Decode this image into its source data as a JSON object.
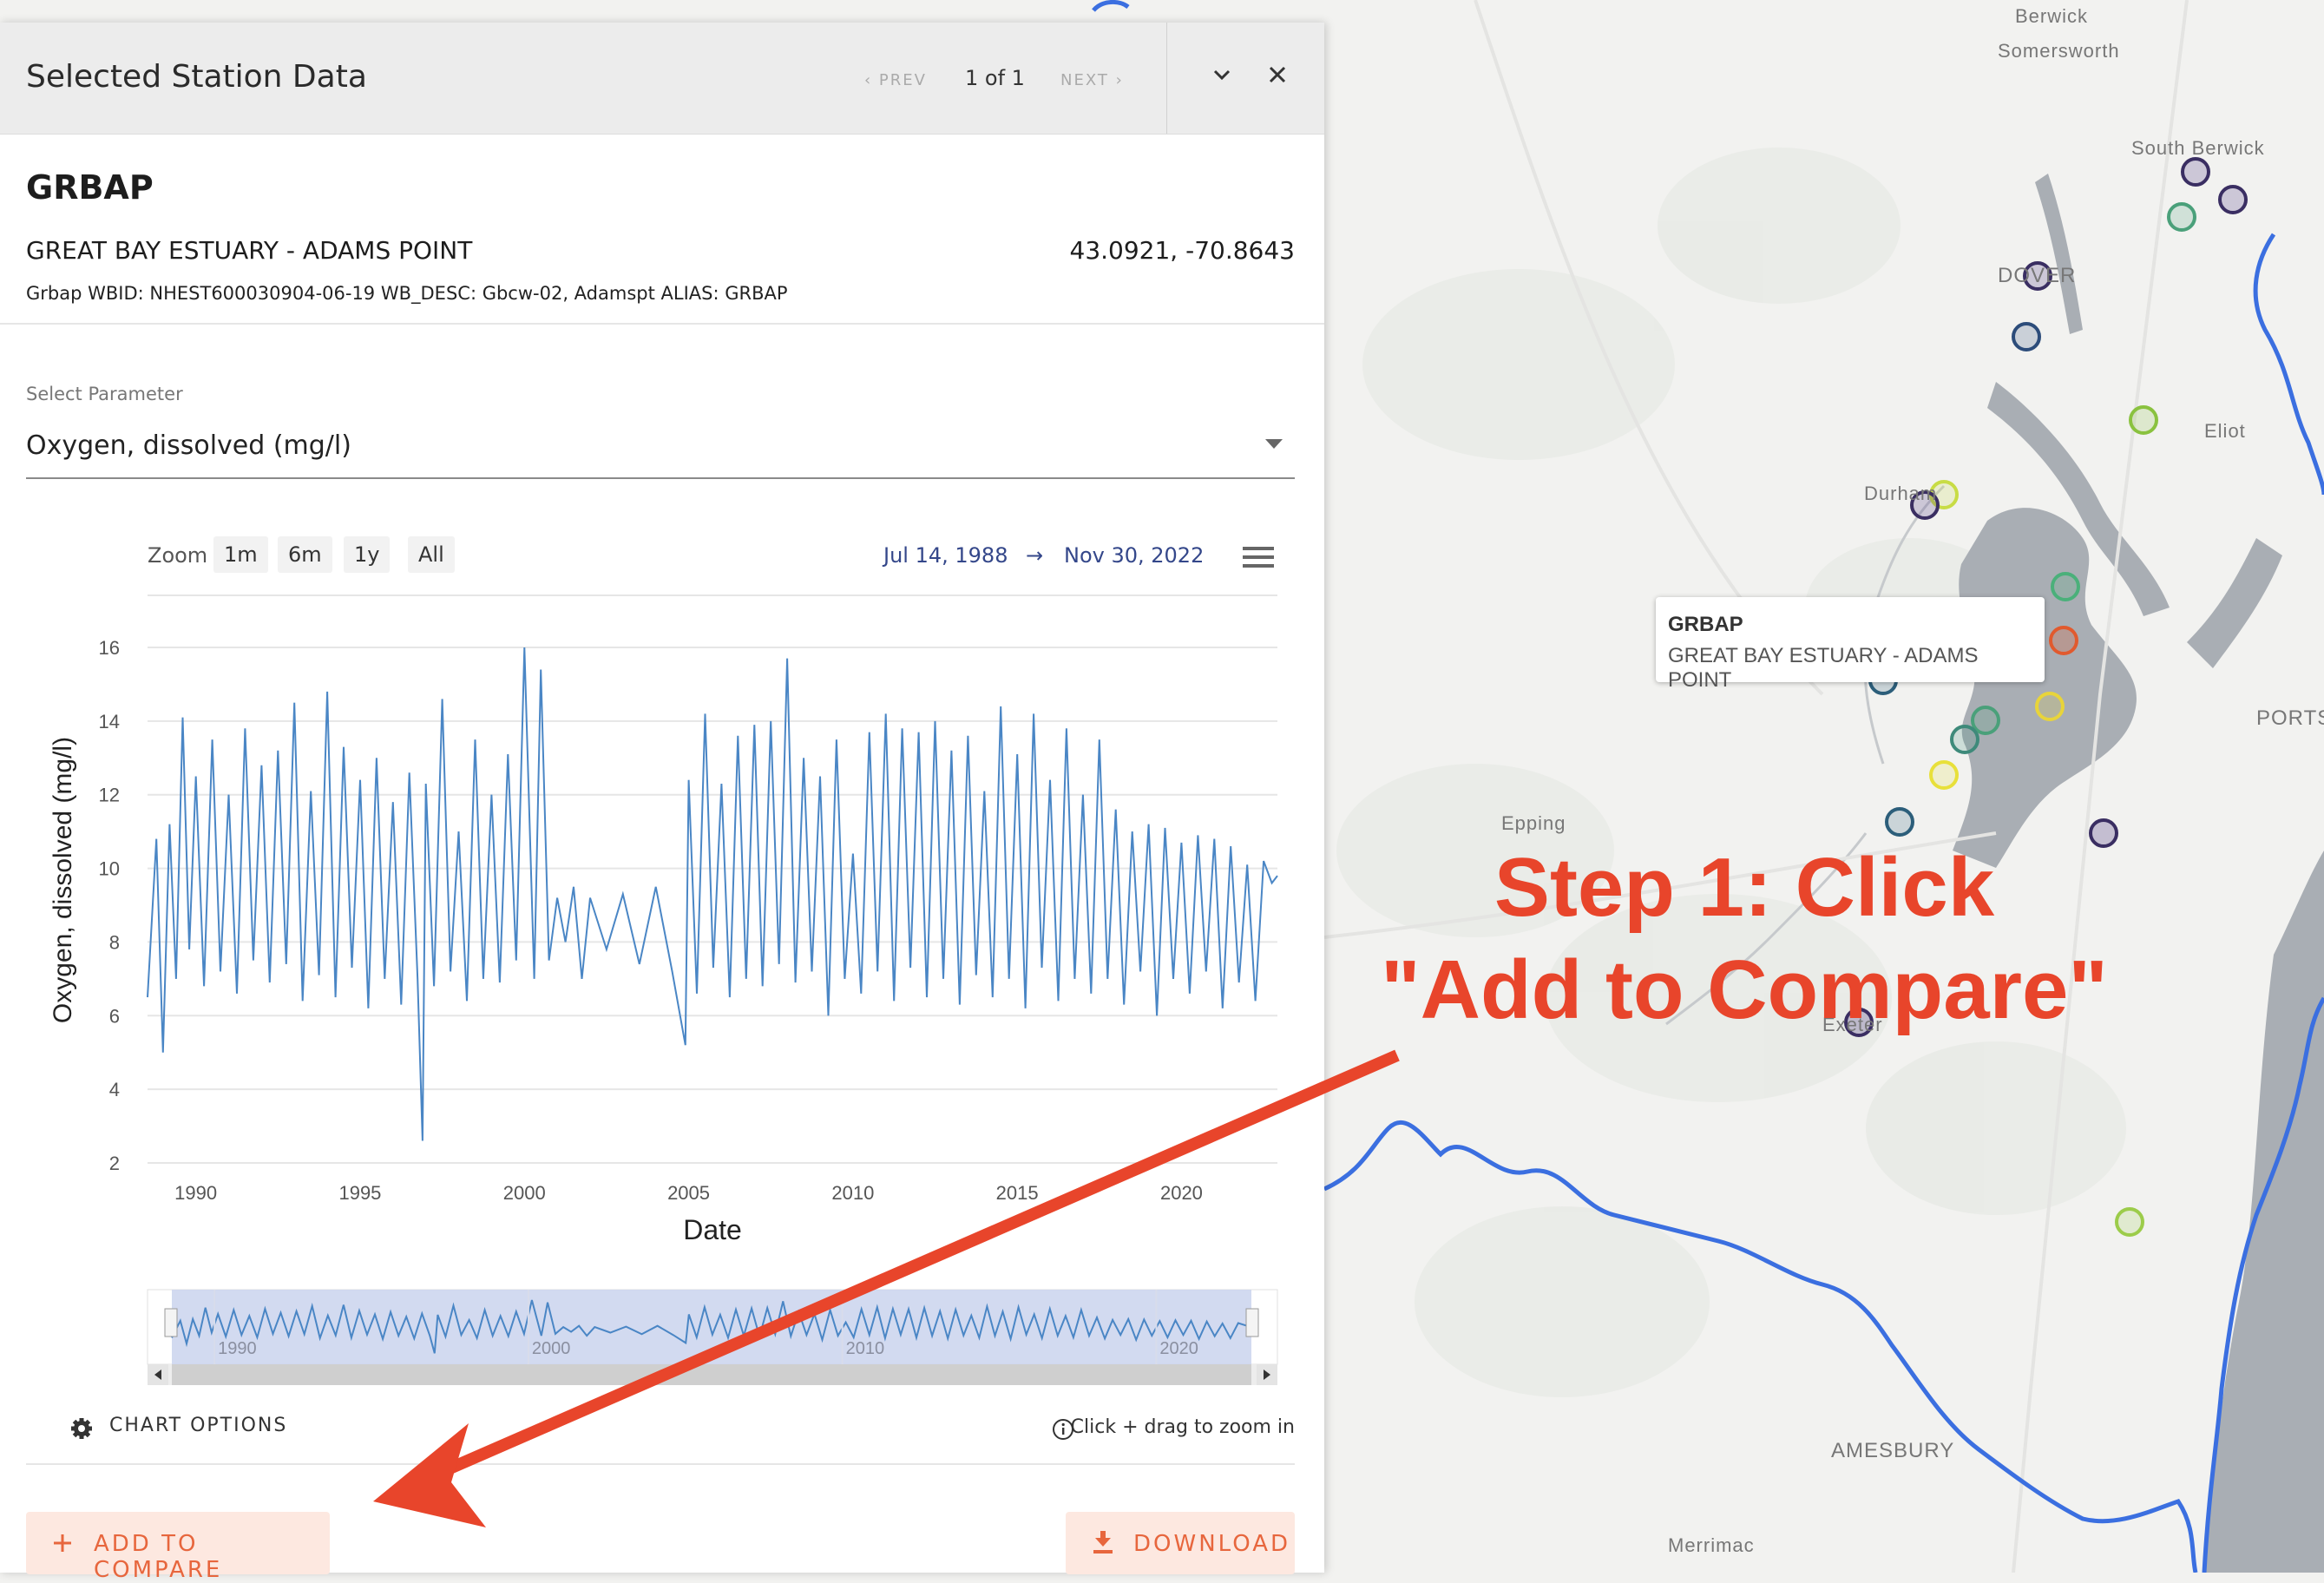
{
  "panel": {
    "title": "Selected Station Data",
    "prev": "‹ PREV",
    "count": "1 of 1",
    "next": "NEXT ›",
    "icons": {
      "collapse": "chevron-down-icon",
      "close": "close-icon"
    }
  },
  "station": {
    "id": "GRBAP",
    "name": "GREAT BAY ESTUARY - ADAMS POINT",
    "coords": "43.0921, -70.8643",
    "meta": "Grbap WBID: NHEST600030904-06-19 WB_DESC: Gbcw-02, Adamspt ALIAS: GRBAP"
  },
  "parameter": {
    "label": "Select Parameter",
    "value": "Oxygen, dissolved (mg/l)"
  },
  "zoom": {
    "label": "Zoom",
    "buttons": [
      "1m",
      "6m",
      "1y",
      "All"
    ],
    "from": "Jul 14, 1988",
    "arrow": "→",
    "to": "Nov 30, 2022"
  },
  "chart_data": {
    "type": "line",
    "ylabel": "Oxygen, dissolved (mg/l)",
    "xlabel": "Date",
    "ylim": [
      2,
      16
    ],
    "yticks": [
      2,
      4,
      6,
      8,
      10,
      12,
      14,
      16
    ],
    "xlim": [
      1988.53,
      2022.92
    ],
    "xticks": [
      1990,
      1995,
      2000,
      2005,
      2010,
      2015,
      2020
    ],
    "navigator_ticks": [
      "1990",
      "2000",
      "2010",
      "2020"
    ],
    "series": [
      {
        "color": "#4a86c5",
        "x": [
          1988.53,
          1988.8,
          1989.0,
          1989.2,
          1989.4,
          1989.6,
          1989.8,
          1990.0,
          1990.25,
          1990.5,
          1990.75,
          1991.0,
          1991.25,
          1991.5,
          1991.75,
          1992.0,
          1992.25,
          1992.5,
          1992.75,
          1993.0,
          1993.25,
          1993.5,
          1993.75,
          1994.0,
          1994.25,
          1994.5,
          1994.75,
          1995.0,
          1995.25,
          1995.5,
          1995.75,
          1996.0,
          1996.25,
          1996.5,
          1996.75,
          1996.9,
          1997.0,
          1997.25,
          1997.5,
          1997.75,
          1998.0,
          1998.25,
          1998.5,
          1998.75,
          1999.0,
          1999.25,
          1999.5,
          1999.75,
          2000.0,
          2000.3,
          2000.5,
          2000.75,
          2001.0,
          2001.25,
          2001.5,
          2001.75,
          2002.0,
          2002.5,
          2003.0,
          2003.5,
          2004.0,
          2004.5,
          2004.9,
          2005.0,
          2005.25,
          2005.5,
          2005.75,
          2006.0,
          2006.25,
          2006.5,
          2006.75,
          2007.0,
          2007.25,
          2007.5,
          2007.75,
          2008.0,
          2008.25,
          2008.5,
          2008.75,
          2009.0,
          2009.25,
          2009.5,
          2009.75,
          2010.0,
          2010.25,
          2010.5,
          2010.75,
          2011.0,
          2011.25,
          2011.5,
          2011.75,
          2012.0,
          2012.25,
          2012.5,
          2012.75,
          2013.0,
          2013.25,
          2013.5,
          2013.75,
          2014.0,
          2014.25,
          2014.5,
          2014.75,
          2015.0,
          2015.25,
          2015.5,
          2015.75,
          2016.0,
          2016.25,
          2016.5,
          2016.75,
          2017.0,
          2017.25,
          2017.5,
          2017.75,
          2018.0,
          2018.25,
          2018.5,
          2018.75,
          2019.0,
          2019.25,
          2019.5,
          2019.75,
          2020.0,
          2020.25,
          2020.5,
          2020.75,
          2021.0,
          2021.25,
          2021.5,
          2021.75,
          2022.0,
          2022.25,
          2022.5,
          2022.75,
          2022.92
        ],
        "values": [
          6.5,
          10.8,
          5.0,
          11.2,
          7.0,
          14.1,
          7.8,
          12.5,
          6.8,
          13.5,
          7.2,
          12.0,
          6.6,
          13.8,
          7.5,
          12.8,
          6.9,
          13.2,
          7.4,
          14.5,
          6.4,
          12.1,
          7.1,
          14.8,
          6.5,
          13.3,
          7.3,
          12.4,
          6.2,
          13.0,
          7.0,
          11.8,
          6.3,
          12.6,
          7.0,
          2.6,
          12.3,
          6.8,
          14.6,
          7.2,
          11.0,
          6.4,
          13.5,
          7.0,
          12.0,
          6.9,
          13.1,
          7.5,
          16.0,
          7.0,
          15.4,
          7.5,
          9.2,
          8.0,
          9.5,
          7.0,
          9.2,
          7.8,
          9.3,
          7.4,
          9.5,
          7.2,
          5.2,
          12.4,
          6.6,
          14.2,
          7.3,
          12.3,
          6.5,
          13.6,
          7.0,
          13.9,
          6.8,
          14.0,
          7.4,
          15.7,
          6.9,
          13.0,
          7.2,
          12.5,
          6.0,
          13.5,
          7.0,
          10.4,
          6.6,
          13.7,
          7.2,
          14.2,
          6.4,
          13.8,
          7.3,
          13.7,
          6.5,
          14.0,
          7.0,
          13.2,
          6.3,
          13.6,
          7.1,
          12.1,
          6.5,
          14.4,
          7.0,
          13.1,
          6.2,
          14.2,
          7.3,
          12.4,
          6.4,
          13.8,
          7.0,
          12.0,
          6.6,
          13.5,
          7.0,
          11.6,
          6.3,
          11.0,
          7.2,
          11.2,
          6.0,
          11.1,
          7.0,
          10.7,
          6.6,
          10.9,
          7.2,
          10.8,
          6.2,
          10.6,
          6.9,
          10.1,
          6.4,
          10.2,
          9.6,
          9.8
        ]
      }
    ]
  },
  "chart_options": {
    "label": "CHART OPTIONS",
    "icon": "gear-icon"
  },
  "hint": {
    "text": "Click + drag to zoom in",
    "icon": "info-icon"
  },
  "actions": {
    "compare": "ADD TO COMPARE",
    "compare_icon": "plus-icon",
    "download": "DOWNLOAD",
    "download_icon": "download-icon"
  },
  "tooltip": {
    "title": "GRBAP",
    "subtitle": "GREAT BAY ESTUARY - ADAMS POINT"
  },
  "annotation": {
    "line1": "Step 1: Click",
    "line2": "\"Add to Compare\"",
    "color": "#e8452b"
  },
  "map": {
    "places": [
      "Berwick",
      "Somersworth",
      "South Berwick",
      "DOVER",
      "Eliot",
      "Durham",
      "Epping",
      "Exeter",
      "PORTS",
      "AMESBURY",
      "Merrimac"
    ],
    "colors": {
      "land": "#f2f2f0",
      "water": "#a9aeb4",
      "boundary": "#3b6fe0"
    }
  }
}
